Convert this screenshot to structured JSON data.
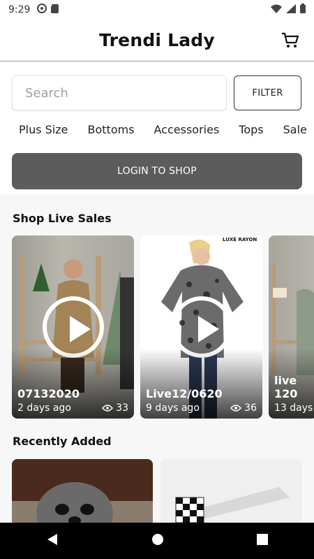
{
  "status_bar": {
    "time": "9:29"
  },
  "header": {
    "title": "Trendi Lady",
    "cart_icon": "cart-icon"
  },
  "search": {
    "placeholder": "Search",
    "value": "",
    "filter_label": "FILTER"
  },
  "categories": [
    "Plus Size",
    "Bottoms",
    "Accessories",
    "Tops",
    "Sale"
  ],
  "login": {
    "label": "LOGIN TO SHOP"
  },
  "live_sales": {
    "title": "Shop Live Sales",
    "items": [
      {
        "name": "07132020",
        "ago": "2 days ago",
        "views": "33"
      },
      {
        "name": "Live12/0620",
        "ago": "9 days ago",
        "views": "36",
        "brand_tag": "LUXE RAYON"
      },
      {
        "name": "live 120",
        "ago": "13 days"
      }
    ]
  },
  "recently_added": {
    "title": "Recently Added"
  },
  "colors": {
    "login_bg": "#5c5c5c",
    "accent": "#111111",
    "section_bg": "#f7f7f7"
  }
}
